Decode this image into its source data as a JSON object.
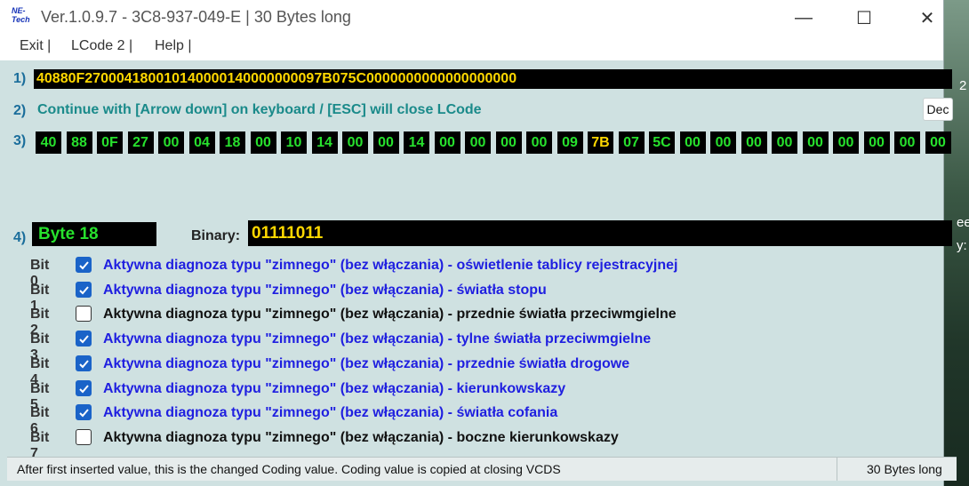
{
  "window": {
    "logo_text": "NE-Tech",
    "title": "Ver.1.0.9.7 -   3C8-937-049-E | 30 Bytes long",
    "controls": {
      "minimize": "—",
      "maximize": "☐",
      "close": "✕"
    }
  },
  "menu": {
    "items": [
      "Exit |",
      "LCode 2 |",
      "Help |"
    ]
  },
  "labels": {
    "row1": "1)",
    "row2": "2)",
    "row3": "3)",
    "row4": "4)",
    "binary": "Binary:"
  },
  "coding_value": "40880F270004180010140000140000000009 7B075C00000000000000000",
  "coding_value_clean": "40880F270004180010140000140000000097B075C0000000000000000000",
  "hint": "Continue with [Arrow down] on keyboard / [ESC] will close LCode",
  "dec_button": "Dec",
  "bytes": [
    "40",
    "88",
    "0F",
    "27",
    "00",
    "04",
    "18",
    "00",
    "10",
    "14",
    "00",
    "00",
    "14",
    "00",
    "00",
    "00",
    "00",
    "09",
    "7B",
    "07",
    "5C",
    "00",
    "00",
    "00",
    "00",
    "00",
    "00",
    "00",
    "00",
    "00"
  ],
  "selected_byte_index": 18,
  "byte_label": "Byte 18",
  "binary_value": "01111011",
  "bits": [
    {
      "name": "Bit 0",
      "checked": true,
      "text": "Aktywna diagnoza typu \"zimnego\" (bez włączania) - oświetlenie tablicy rejestracyjnej"
    },
    {
      "name": "Bit 1",
      "checked": true,
      "text": "Aktywna diagnoza typu \"zimnego\" (bez włączania) - światła stopu"
    },
    {
      "name": "Bit 2",
      "checked": false,
      "text": "Aktywna diagnoza typu \"zimnego\" (bez włączania) - przednie światła przeciwmgielne"
    },
    {
      "name": "Bit 3",
      "checked": true,
      "text": "Aktywna diagnoza typu \"zimnego\" (bez włączania) - tylne światła przeciwmgielne"
    },
    {
      "name": "Bit 4",
      "checked": true,
      "text": "Aktywna diagnoza typu \"zimnego\" (bez włączania) - przednie światła drogowe"
    },
    {
      "name": "Bit 5",
      "checked": true,
      "text": "Aktywna diagnoza typu \"zimnego\" (bez włączania) - kierunkowskazy"
    },
    {
      "name": "Bit 6",
      "checked": true,
      "text": "Aktywna diagnoza typu \"zimnego\" (bez włączania) - światła cofania"
    },
    {
      "name": "Bit 7",
      "checked": false,
      "text": "Aktywna diagnoza typu \"zimnego\" (bez włączania) - boczne kierunkowskazy"
    }
  ],
  "status": {
    "message": "After first inserted value, this is the changed Coding value.  Coding value is copied at closing VCDS",
    "size": "30 Bytes long"
  },
  "background": {
    "texts": [
      "2",
      "ee",
      "y:"
    ]
  }
}
